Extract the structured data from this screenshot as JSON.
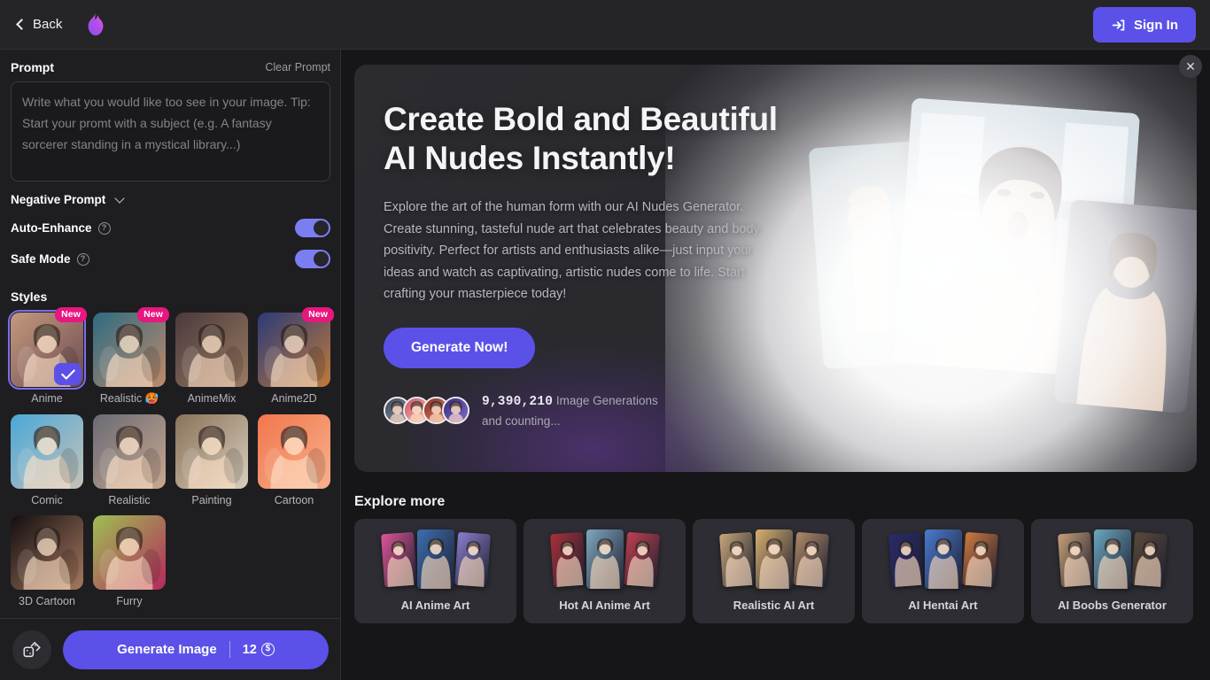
{
  "header": {
    "back_label": "Back",
    "logo_icon": "flame-icon",
    "signin_label": "Sign In",
    "signin_icon": "login-arrow-icon",
    "accent_color": "#5b51e8",
    "bar_color": "#252528"
  },
  "sidebar": {
    "prompt_title": "Prompt",
    "clear_prompt_label": "Clear Prompt",
    "prompt_value": "",
    "prompt_placeholder": "Write what you would like too see in your image. Tip: Start your promt with a subject (e.g. A fantasy sorcerer standing in a mystical library...)",
    "negative_prompt_label": "Negative Prompt",
    "negative_prompt_icon": "chevron-down-icon",
    "auto_enhance_label": "Auto-Enhance",
    "auto_enhance_on": true,
    "safe_mode_label": "Safe Mode",
    "safe_mode_on": true,
    "help_icon": "question-circle-icon",
    "styles_title": "Styles",
    "styles": [
      {
        "label": "Anime",
        "badge": "New",
        "selected": true,
        "c1": "#c49a7e",
        "c2": "#6a4a52"
      },
      {
        "label": "Realistic 🥵",
        "badge": "New",
        "selected": false,
        "c1": "#2d6b82",
        "c2": "#c08a6a"
      },
      {
        "label": "AnimeMix",
        "badge": "",
        "selected": false,
        "c1": "#4a3a3c",
        "c2": "#9a7a62"
      },
      {
        "label": "Anime2D",
        "badge": "New",
        "selected": false,
        "c1": "#2a3a78",
        "c2": "#c07a3a"
      },
      {
        "label": "Comic",
        "badge": "",
        "selected": false,
        "c1": "#4aa8d8",
        "c2": "#c7c2b8"
      },
      {
        "label": "Realistic",
        "badge": "",
        "selected": false,
        "c1": "#6a6a74",
        "c2": "#c9a890"
      },
      {
        "label": "Painting",
        "badge": "",
        "selected": false,
        "c1": "#8a7258",
        "c2": "#d8cdbe"
      },
      {
        "label": "Cartoon",
        "badge": "",
        "selected": false,
        "c1": "#f2764c",
        "c2": "#f7b18c"
      },
      {
        "label": "3D Cartoon",
        "badge": "",
        "selected": false,
        "c1": "#120d10",
        "c2": "#a6795e"
      },
      {
        "label": "Furry",
        "badge": "",
        "selected": false,
        "c1": "#9dbf52",
        "c2": "#b5285e"
      }
    ],
    "checkmark_icon": "check-icon",
    "dice_icon": "dice-icon",
    "generate_label": "Generate Image",
    "generate_cost": "12",
    "coin_icon": "coin-icon"
  },
  "hero": {
    "close_icon": "close-icon",
    "title_line1": "Create Bold and Beautiful",
    "title_line2": "AI Nudes Instantly!",
    "subtitle": "Explore the art of the human form with our AI Nudes Generator. Create stunning, tasteful nude art that celebrates beauty and body positivity. Perfect for artists and enthusiasts alike—just input your ideas and watch as captivating, artistic nudes come to life. Start crafting your masterpiece today!",
    "cta_label": "Generate Now!",
    "stats_count": "9,390,210",
    "stats_label": "Image Generations",
    "stats_sub": "and counting...",
    "avatars": [
      {
        "c1": "#3e4a5e",
        "c2": "#8a93a6"
      },
      {
        "c1": "#d8516a",
        "c2": "#e9c9b0"
      },
      {
        "c1": "#8e2b24",
        "c2": "#d78f6c"
      },
      {
        "c1": "#3a2a7a",
        "c2": "#7e6ed0"
      }
    ]
  },
  "explore": {
    "title": "Explore more",
    "cards": [
      {
        "label": "AI Anime Art",
        "c1": "#e0559a",
        "c2": "#3b6fb0",
        "c3": "#8a7fd0"
      },
      {
        "label": "Hot AI Anime Art",
        "c1": "#a8313a",
        "c2": "#7fa8c0",
        "c3": "#c04050"
      },
      {
        "label": "Realistic AI Art",
        "c1": "#c9a87a",
        "c2": "#d8b070",
        "c3": "#b08a68"
      },
      {
        "label": "AI Hentai Art",
        "c1": "#2a2a6a",
        "c2": "#4a7ad0",
        "c3": "#d07a40"
      },
      {
        "label": "AI Boobs Generator",
        "c1": "#c8a078",
        "c2": "#6aa8c0",
        "c3": "#5a4a3a"
      }
    ]
  }
}
